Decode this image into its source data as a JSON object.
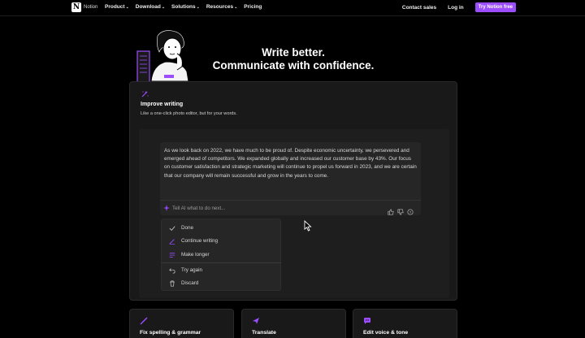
{
  "nav": {
    "brand": "Notion",
    "links": [
      {
        "label": "Product",
        "dropdown": true
      },
      {
        "label": "Download",
        "dropdown": true
      },
      {
        "label": "Solutions",
        "dropdown": true
      },
      {
        "label": "Resources",
        "dropdown": true
      },
      {
        "label": "Pricing",
        "dropdown": false
      }
    ],
    "contact_sales": "Contact sales",
    "login": "Log in",
    "cta": "Try Notion free"
  },
  "hero": {
    "line1": "Write better.",
    "line2": "Communicate with confidence."
  },
  "feature": {
    "icon": "sparkle-wand-icon",
    "title": "Improve writing",
    "subtitle": "Like a one-click photo editor, but for your words.",
    "document_text": "As we look back on 2022, we have much to be proud of. Despite economic uncertainty, we persevered and emerged ahead of competitors. We expanded globally and increased our customer base by 43%. Our focus on customer satisfaction and strategic marketing will continue to propel us forward in 2023, and we are certain that our company will remain successful and grow in the years to come.",
    "ask_placeholder": "Tell AI what to do next...",
    "menu": [
      {
        "label": "Done",
        "icon": "check-icon"
      },
      {
        "label": "Continue writing",
        "icon": "pen-icon"
      },
      {
        "label": "Make longer",
        "icon": "lines-icon"
      },
      {
        "label": "Try again",
        "icon": "undo-icon"
      },
      {
        "label": "Discard",
        "icon": "trash-icon"
      }
    ]
  },
  "cards": [
    {
      "title": "Fix spelling & grammar",
      "icon": "pencil-icon"
    },
    {
      "title": "Translate",
      "icon": "send-icon"
    },
    {
      "title": "Edit voice & tone",
      "icon": "chat-bubble-icon"
    }
  ],
  "colors": {
    "accent": "#9b4dff",
    "background": "#000000",
    "card": "#191919"
  }
}
